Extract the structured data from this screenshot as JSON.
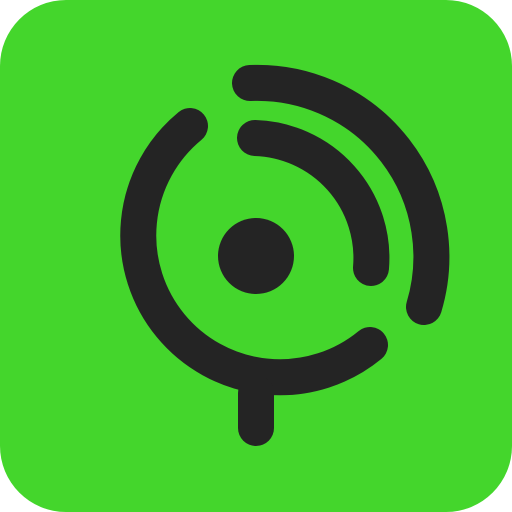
{
  "icon": {
    "name": "app-icon",
    "symbol": "broadcast-signal-icon",
    "colors": {
      "background": "#44D62C",
      "glyph": "#242424"
    }
  }
}
